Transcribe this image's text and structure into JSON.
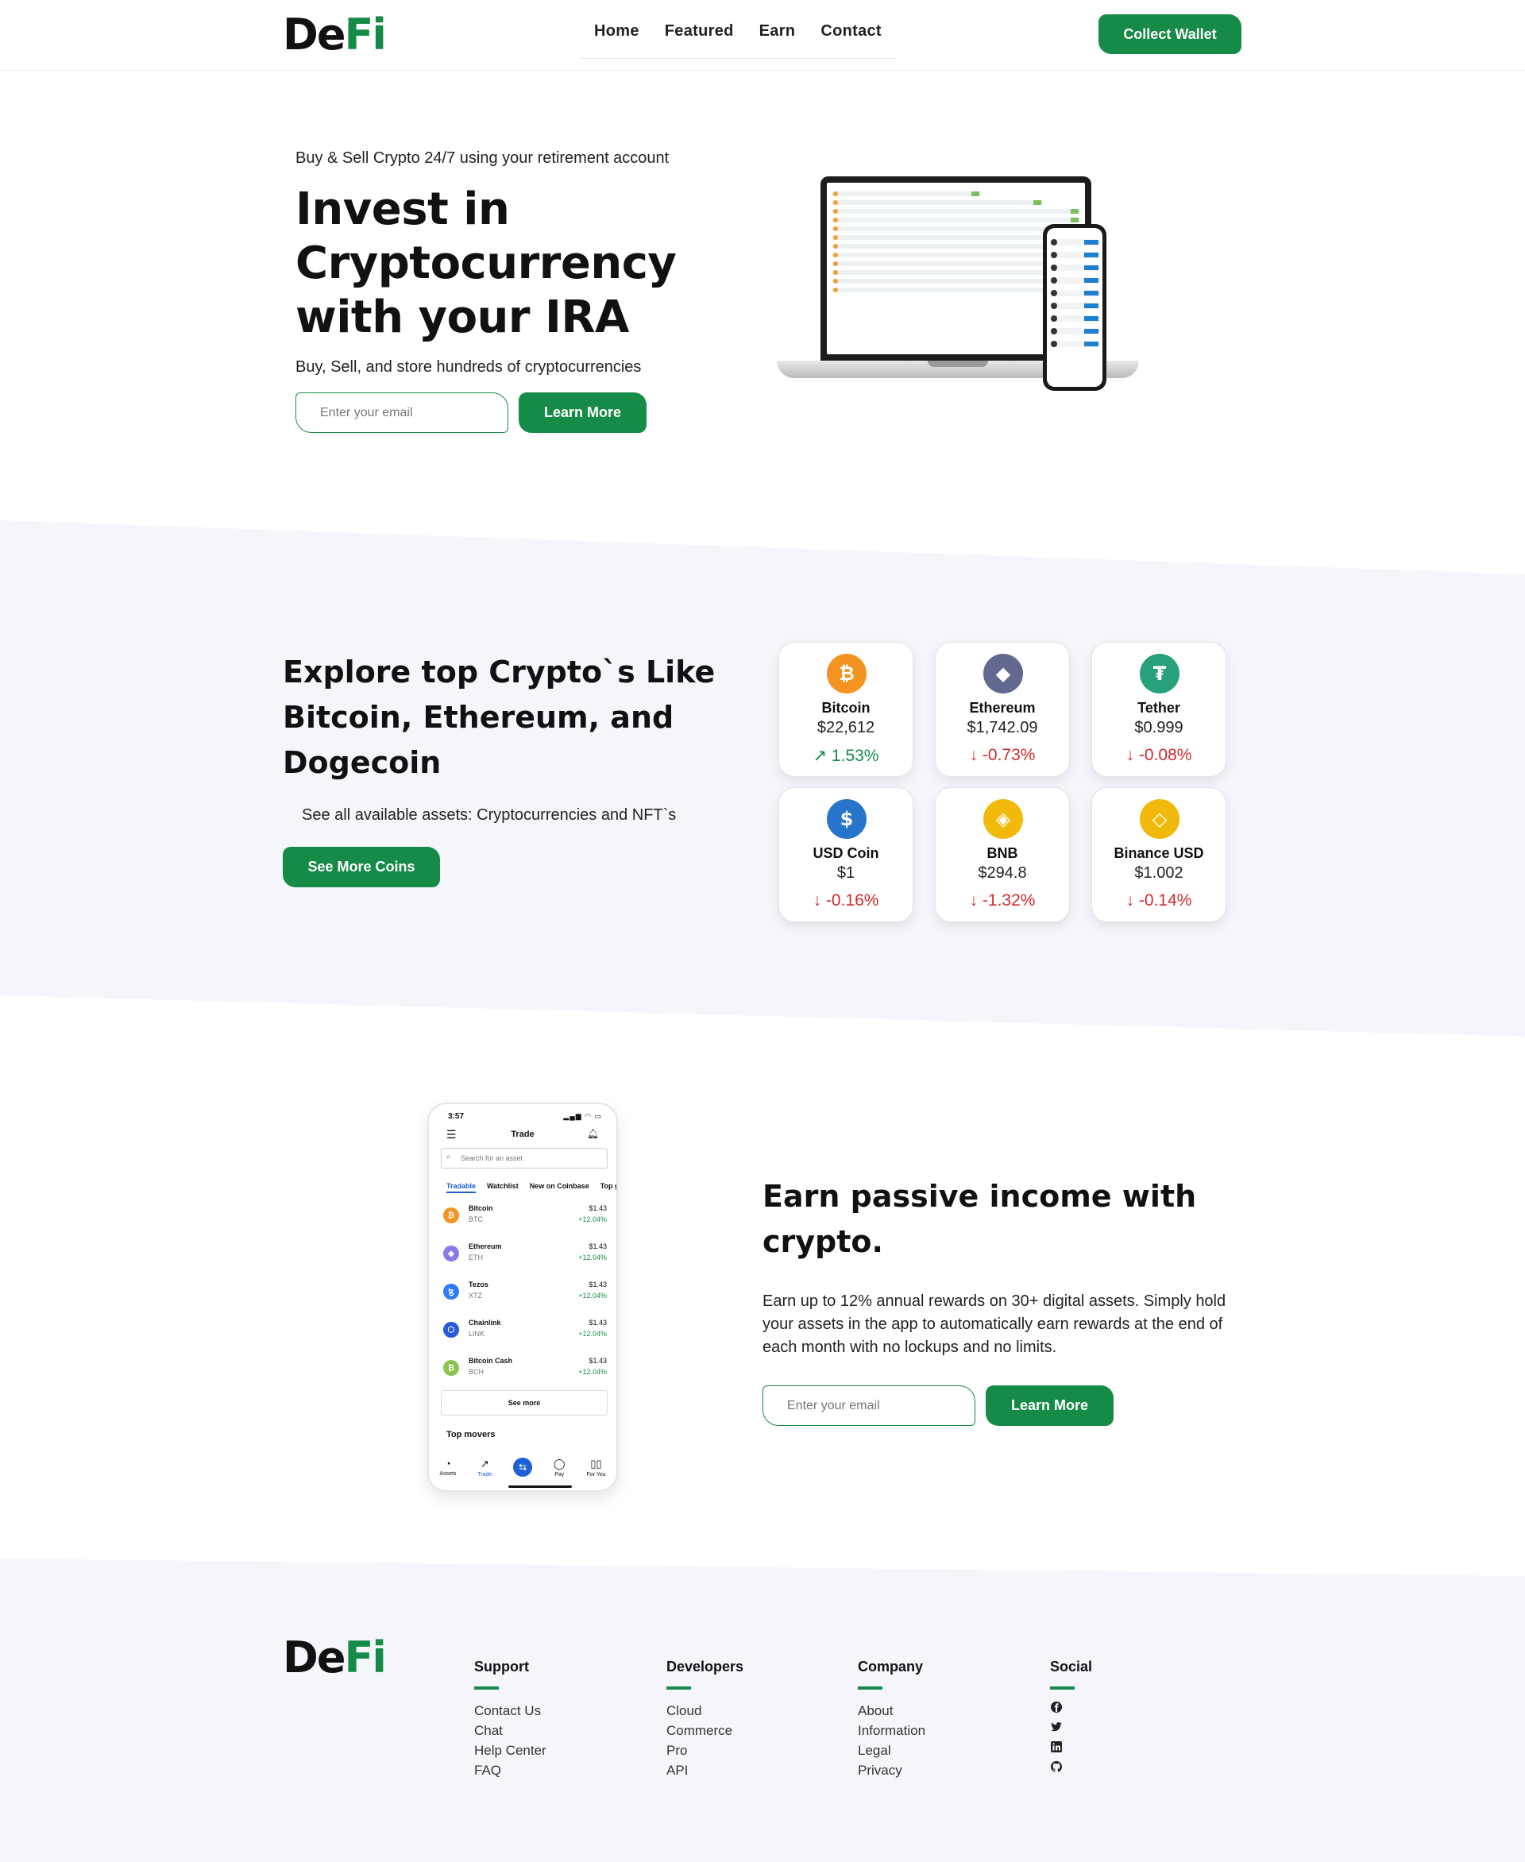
{
  "header": {
    "logo_de": "De",
    "logo_fi": "Fi",
    "nav": [
      "Home",
      "Featured",
      "Earn",
      "Contact"
    ],
    "collect_label": "Collect Wallet"
  },
  "hero": {
    "kicker": "Buy & Sell Crypto 24/7 using your retirement account",
    "title": "Invest in Cryptocurrency with your IRA",
    "subtitle": "Buy, Sell, and store hundreds of cryptocurrencies",
    "email_placeholder": "Enter your email",
    "learn_label": "Learn More"
  },
  "explore": {
    "title": "Explore top Crypto`s Like Bitcoin, Ethereum, and Dogecoin",
    "subtitle": "See all available assets: Cryptocurrencies and NFT`s",
    "button_label": "See More Coins",
    "coins": [
      {
        "name": "Bitcoin",
        "price": "$22,612",
        "change": "↗ 1.53%",
        "trend": "up",
        "color": "#f39321",
        "icon": "bitcoin-icon",
        "glyph": "₿"
      },
      {
        "name": "Ethereum",
        "price": "$1,742.09",
        "change": "↓ -0.73%",
        "trend": "down",
        "color": "#62688f",
        "icon": "ethereum-icon",
        "glyph": "◆"
      },
      {
        "name": "Tether",
        "price": "$0.999",
        "change": "↓ -0.08%",
        "trend": "down",
        "color": "#26a17b",
        "icon": "tether-icon",
        "glyph": "₮"
      },
      {
        "name": "USD Coin",
        "price": "$1",
        "change": "↓ -0.16%",
        "trend": "down",
        "color": "#2775ca",
        "icon": "usd-coin-icon",
        "glyph": "$"
      },
      {
        "name": "BNB",
        "price": "$294.8",
        "change": "↓ -1.32%",
        "trend": "down",
        "color": "#f0b90b",
        "icon": "bnb-icon",
        "glyph": "◈"
      },
      {
        "name": "Binance USD",
        "price": "$1.002",
        "change": "↓ -0.14%",
        "trend": "down",
        "color": "#f0b90b",
        "icon": "binance-usd-icon",
        "glyph": "◇"
      }
    ]
  },
  "phone": {
    "time": "3:57",
    "status_icons": "▂▄▆ ◠ ▭",
    "title": "Trade",
    "search_placeholder": "Search for an asset",
    "tabs": [
      "Tradable",
      "Watchlist",
      "New on Coinbase",
      "Top g"
    ],
    "assets": [
      {
        "name": "Bitcoin",
        "ticker": "BTC",
        "price": "$1.43",
        "change": "+12.04%",
        "color": "#f39321",
        "glyph": "₿"
      },
      {
        "name": "Ethereum",
        "ticker": "ETH",
        "price": "$1.43",
        "change": "+12.04%",
        "color": "#8a7ae8",
        "glyph": "◆"
      },
      {
        "name": "Tezos",
        "ticker": "XTZ",
        "price": "$1.43",
        "change": "+12.04%",
        "color": "#2c7df7",
        "glyph": "ꜩ"
      },
      {
        "name": "Chainlink",
        "ticker": "LINK",
        "price": "$1.43",
        "change": "+12.04%",
        "color": "#2a5ada",
        "glyph": "⬡"
      },
      {
        "name": "Bitcoin Cash",
        "ticker": "BCH",
        "price": "$1.43",
        "change": "+12.04%",
        "color": "#8dc351",
        "glyph": "₿"
      }
    ],
    "see_more": "See more",
    "top_movers": "Top movers",
    "nav": [
      {
        "label": "Assets",
        "glyph": "◔"
      },
      {
        "label": "Trade",
        "glyph": "↗"
      },
      {
        "label": "",
        "glyph": "⇆"
      },
      {
        "label": "Pay",
        "glyph": "◯"
      },
      {
        "label": "For You",
        "glyph": "▯▯"
      }
    ]
  },
  "earn": {
    "title": "Earn passive income with crypto.",
    "text": "Earn up to 12% annual rewards on 30+ digital assets. Simply hold your assets in the app to automatically earn rewards at the end of each month with no lockups and no limits.",
    "email_placeholder": "Enter your email",
    "learn_label": "Learn More"
  },
  "footer": {
    "support": {
      "title": "Support",
      "links": [
        "Contact Us",
        "Chat",
        "Help Center",
        "FAQ"
      ]
    },
    "developers": {
      "title": "Developers",
      "links": [
        "Cloud",
        "Commerce",
        "Pro",
        "API"
      ]
    },
    "company": {
      "title": "Company",
      "links": [
        "About",
        "Information",
        "Legal",
        "Privacy"
      ]
    },
    "social": {
      "title": "Social",
      "icons": [
        "facebook-icon",
        "twitter-icon",
        "linkedin-icon",
        "github-icon"
      ]
    }
  },
  "colors": {
    "brand": "#168a47",
    "up": "#168a47",
    "down": "#d02b2b",
    "band": "#f4f6fc"
  }
}
